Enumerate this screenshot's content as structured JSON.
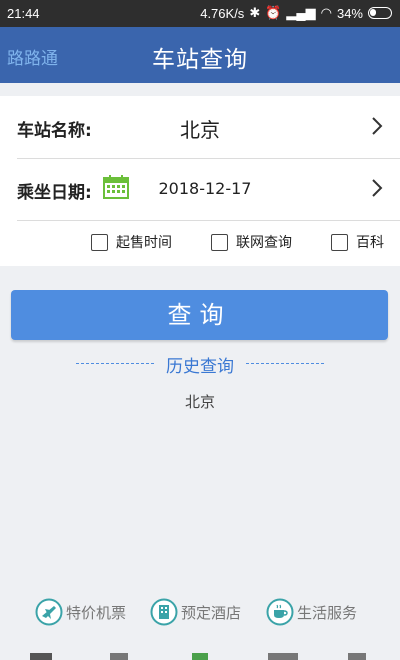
{
  "status_bar": {
    "time": "21:44",
    "net_speed": "4.76K/s",
    "battery": "34%"
  },
  "header": {
    "left_label": "路路通",
    "title": "车站查询"
  },
  "form": {
    "station_label": "车站名称:",
    "station_value": "北京",
    "date_label": "乘坐日期:",
    "date_value": "2018-12-17",
    "options": [
      {
        "label": "起售时间",
        "checked": false
      },
      {
        "label": "联网查询",
        "checked": false
      },
      {
        "label": "百科",
        "checked": false
      }
    ]
  },
  "query_button": "查询",
  "history": {
    "title": "历史查询",
    "items": [
      "北京"
    ]
  },
  "services": [
    {
      "label": "特价机票",
      "icon": "plane-icon"
    },
    {
      "label": "预定酒店",
      "icon": "hotel-icon"
    },
    {
      "label": "生活服务",
      "icon": "coffee-icon"
    }
  ],
  "colors": {
    "header": "#3a65ad",
    "accent": "#4f8de0",
    "status_bar": "#2e2e2e",
    "calendar": "#6bbf3a"
  }
}
